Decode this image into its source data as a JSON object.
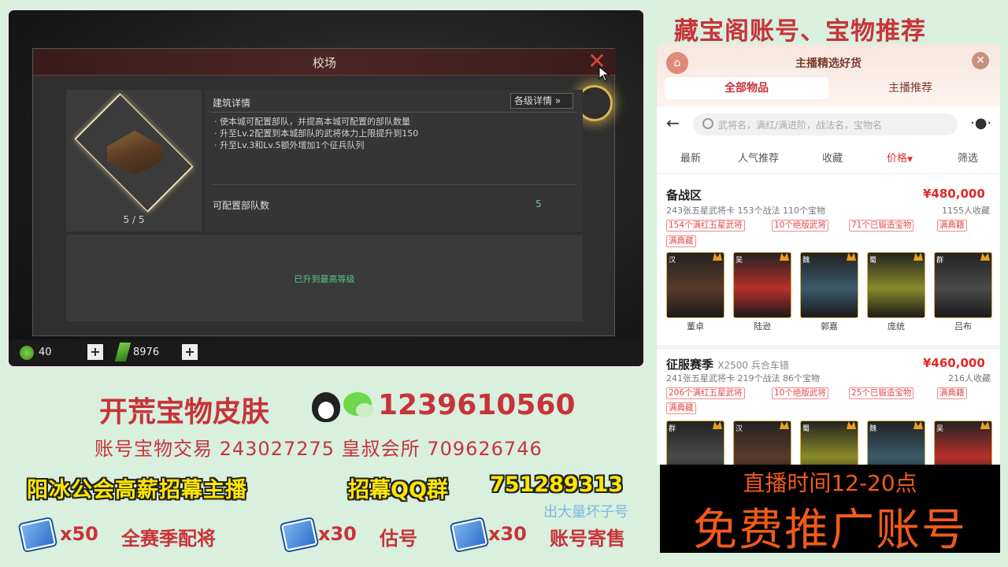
{
  "game": {
    "dialog_title": "校场",
    "building_count": "5 / 5",
    "info_heading": "建筑详情",
    "detail_button": "各级详情 »",
    "info_lines": [
      "· 使本城可配置部队，并提高本城可配置的部队数量",
      "· 升至Lv.2配置到本城部队的武将体力上限提升到150",
      "· 升至Lv.3和Lv.5额外增加1个征兵队列"
    ],
    "troop_label": "可配置部队数",
    "troop_value": "5",
    "max_level_text": "已升到最高等级",
    "resource1_value": "40",
    "resource2_value": "8976",
    "plus_symbol": "+"
  },
  "overlay": {
    "right_banner": "藏宝阁账号、宝物推荐",
    "contact_prefix": "开荒宝物皮肤",
    "contact_number": "1239610560",
    "trade_line": "账号宝物交易 243027275  皇叔会所 709626746",
    "recruit_text": "阳冰公会高薪招幕主播",
    "recruit_group_label": "招幕QQ群",
    "recruit_group_number": "751289313",
    "bad_account": "出大量坏子号",
    "bonuses": [
      {
        "count": "x50",
        "label": "全赛季配将"
      },
      {
        "count": "x30",
        "label": "估号"
      },
      {
        "count": "x30",
        "label": "账号寄售"
      }
    ]
  },
  "phone": {
    "title": "主播精选好货",
    "tab_all": "全部物品",
    "tab_recommend": "主播推荐",
    "search_placeholder": "武将名，满红/满进阶，战法名，宝物名",
    "filters": [
      "最新",
      "人气推荐",
      "收藏",
      "价格",
      "筛选"
    ],
    "items": [
      {
        "title": "备战区",
        "subtitle": "",
        "price": "¥480,000",
        "meta": "243张五星武将卡   153个战法   110个宝物",
        "fav": "1155人收藏",
        "tags": [
          "154个满红五星武将",
          "10个绝版武将",
          "71个已锻造宝物",
          "满典籍",
          "满典藏"
        ],
        "heroes": [
          {
            "faction": "汉",
            "name": "董卓",
            "color": "#5a3a2a"
          },
          {
            "faction": "吴",
            "name": "陆逊",
            "color": "#b8302a"
          },
          {
            "faction": "魏",
            "name": "郭嘉",
            "color": "#3a5a6a"
          },
          {
            "faction": "蜀",
            "name": "庞统",
            "color": "#8a8a2a"
          },
          {
            "faction": "群",
            "name": "吕布",
            "color": "#4a4a4a"
          }
        ]
      },
      {
        "title": "征服赛季",
        "subtitle": "X2500 兵合车错",
        "price": "¥460,000",
        "meta": "241张五星武将卡   219个战法   86个宝物",
        "fav": "216人收藏",
        "tags": [
          "206个满红五星武将",
          "10个绝版武将",
          "25个已锻造宝物",
          "满典籍",
          "满典藏"
        ],
        "heroes": [
          {
            "faction": "群",
            "name": "",
            "color": "#4a4a4a"
          },
          {
            "faction": "汉",
            "name": "",
            "color": "#5a3a2a"
          },
          {
            "faction": "蜀",
            "name": "",
            "color": "#8a8a2a"
          },
          {
            "faction": "魏",
            "name": "",
            "color": "#3a5a6a"
          },
          {
            "faction": "吴",
            "name": "",
            "color": "#b8302a"
          }
        ]
      }
    ]
  },
  "promo": {
    "time": "直播时间12-20点",
    "main": "免费推广账号"
  }
}
